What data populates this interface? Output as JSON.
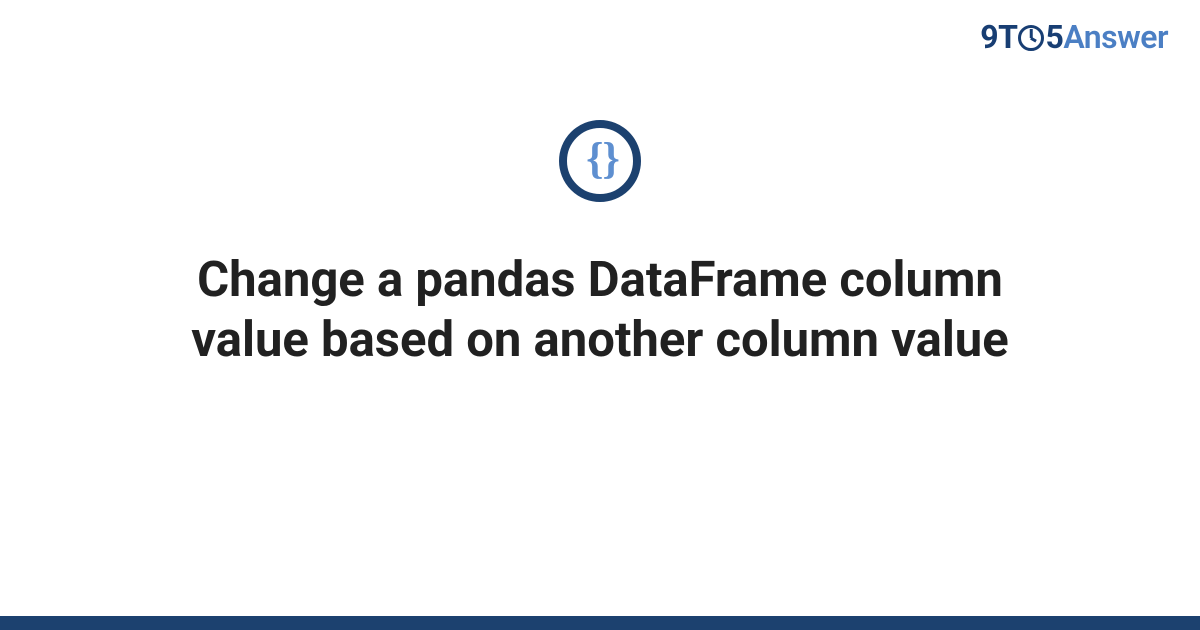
{
  "brand": {
    "part_9": "9",
    "part_T": "T",
    "part_5": "5",
    "part_answer": "Answer"
  },
  "badge": {
    "glyph": "{ }"
  },
  "title": "Change a pandas DataFrame column value based on another column value",
  "colors": {
    "brand_dark": "#183e73",
    "brand_light": "#4b7fc4",
    "ring": "#1c416f",
    "brace": "#5e8fd0",
    "text": "#212121"
  }
}
